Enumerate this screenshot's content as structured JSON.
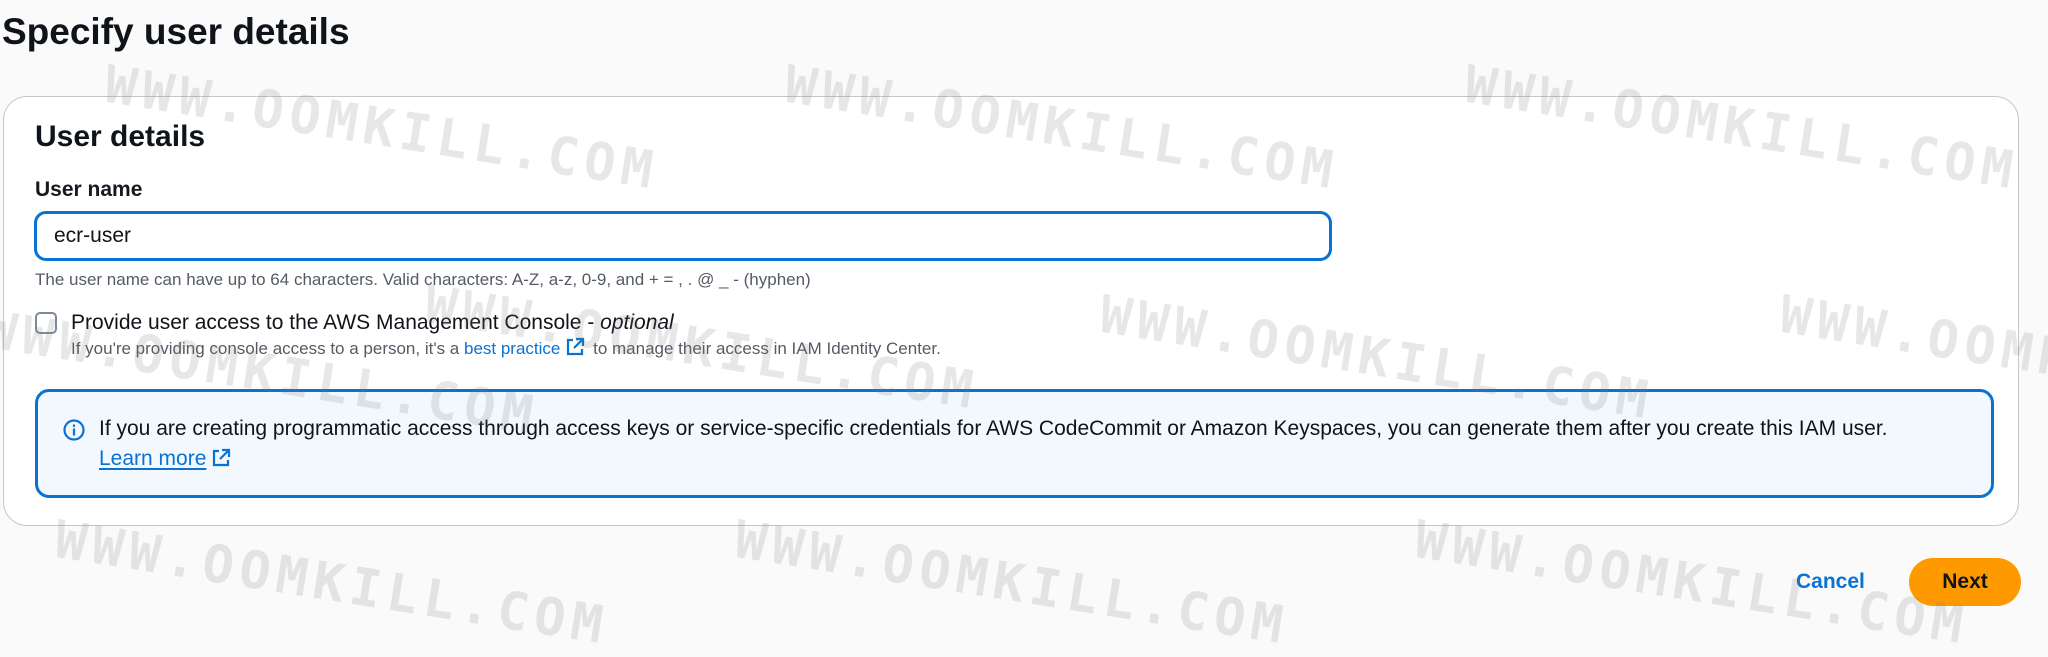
{
  "page": {
    "title": "Specify user details"
  },
  "user_details": {
    "title": "User details",
    "user_name_label": "User name",
    "user_name_value": "ecr-user",
    "user_name_constraint": "The user name can have up to 64 characters. Valid characters: A-Z, a-z, 0-9, and + = , . @ _ - (hyphen)",
    "console_access": {
      "label": "Provide user access to the AWS Management Console - ",
      "optional": "optional",
      "checked": false,
      "desc_before": "If you're providing console access to a person, it's a ",
      "link_text": "best practice",
      "desc_after": " to manage their access in IAM Identity Center."
    },
    "info_alert": {
      "icon": "info-icon",
      "text": "If you are creating programmatic access through access keys or service-specific credentials for AWS CodeCommit or Amazon Keyspaces, you can generate them after you create this IAM user.",
      "link_text": "Learn more"
    }
  },
  "actions": {
    "cancel_label": "Cancel",
    "next_label": "Next"
  },
  "watermark": {
    "text": "WWW.OOMKILL.COM"
  },
  "colors": {
    "accent": "#0972d3",
    "primary_button": "#ff9900",
    "info_background": "#f2f8fd"
  }
}
